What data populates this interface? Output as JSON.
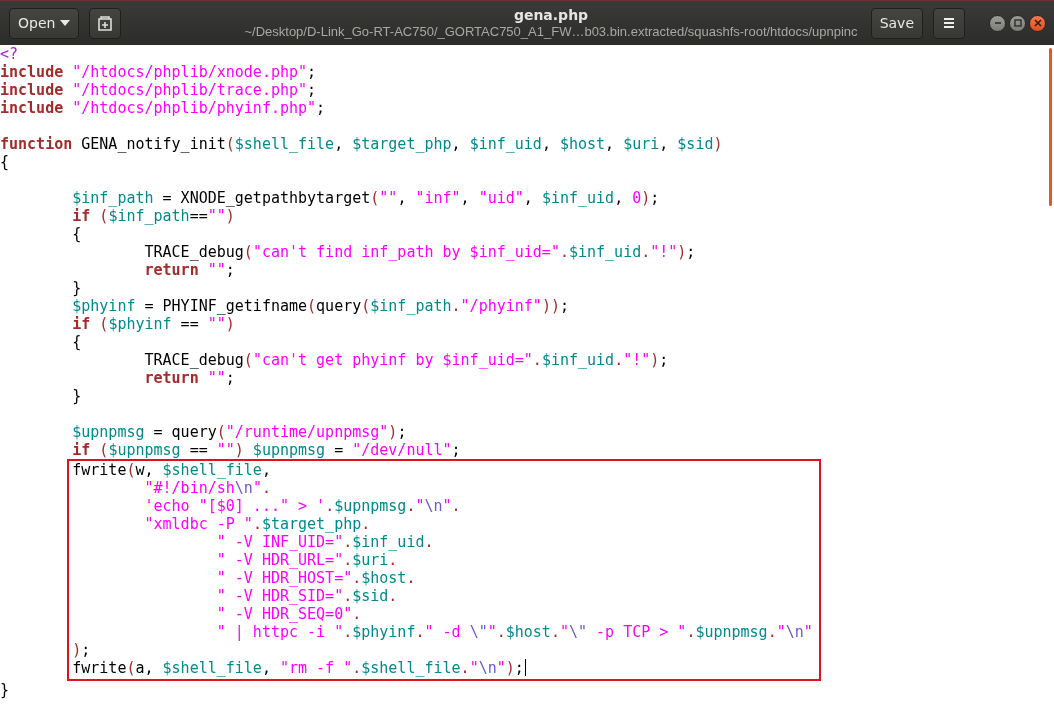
{
  "window": {
    "title": "gena.php",
    "subtitle": "~/Desktop/D-Link_Go-RT-AC750/_GORTAC750_A1_FW…b03.bin.extracted/squashfs-root/htdocs/upnpinc",
    "open_button": "Open",
    "save_button": "Save"
  },
  "editor": {
    "segments": [
      {
        "highlighted": false,
        "blocks": [
          {
            "lines": [
              {
                "tokens": [
                  {
                    "kind": "tag",
                    "text": "<?"
                  }
                ]
              },
              {
                "tokens": [
                  {
                    "kind": "keyword",
                    "text": "include "
                  },
                  {
                    "kind": "string",
                    "text": "\"/htdocs/phplib/xnode.php\""
                  },
                  {
                    "kind": "plain",
                    "text": ";"
                  }
                ]
              },
              {
                "tokens": [
                  {
                    "kind": "keyword",
                    "text": "include "
                  },
                  {
                    "kind": "string",
                    "text": "\"/htdocs/phplib/trace.php\""
                  },
                  {
                    "kind": "plain",
                    "text": ";"
                  }
                ]
              },
              {
                "tokens": [
                  {
                    "kind": "keyword",
                    "text": "include "
                  },
                  {
                    "kind": "string",
                    "text": "\"/htdocs/phplib/phyinf.php\""
                  },
                  {
                    "kind": "plain",
                    "text": ";"
                  }
                ]
              }
            ]
          },
          {
            "lines": [
              {
                "tokens": [
                  {
                    "kind": "keyword",
                    "text": "function "
                  },
                  {
                    "kind": "plain",
                    "text": "GENA_notify_init"
                  },
                  {
                    "kind": "op",
                    "text": "("
                  },
                  {
                    "kind": "variable",
                    "text": "$shell_file"
                  },
                  {
                    "kind": "plain",
                    "text": ", "
                  },
                  {
                    "kind": "variable",
                    "text": "$target_php"
                  },
                  {
                    "kind": "plain",
                    "text": ", "
                  },
                  {
                    "kind": "variable",
                    "text": "$inf_uid"
                  },
                  {
                    "kind": "plain",
                    "text": ", "
                  },
                  {
                    "kind": "variable",
                    "text": "$host"
                  },
                  {
                    "kind": "plain",
                    "text": ", "
                  },
                  {
                    "kind": "variable",
                    "text": "$uri"
                  },
                  {
                    "kind": "plain",
                    "text": ", "
                  },
                  {
                    "kind": "variable",
                    "text": "$sid"
                  },
                  {
                    "kind": "op",
                    "text": ")"
                  }
                ]
              },
              {
                "tokens": [
                  {
                    "kind": "plain",
                    "text": "{"
                  }
                ]
              }
            ]
          },
          {
            "lines": [
              {
                "tokens": [
                  {
                    "kind": "variable",
                    "text": "\t$inf_path"
                  },
                  {
                    "kind": "plain",
                    "text": " = XNODE_getpathbytarget"
                  },
                  {
                    "kind": "op",
                    "text": "("
                  },
                  {
                    "kind": "string",
                    "text": "\"\""
                  },
                  {
                    "kind": "plain",
                    "text": ", "
                  },
                  {
                    "kind": "string",
                    "text": "\"inf\""
                  },
                  {
                    "kind": "plain",
                    "text": ", "
                  },
                  {
                    "kind": "string",
                    "text": "\"uid\""
                  },
                  {
                    "kind": "plain",
                    "text": ", "
                  },
                  {
                    "kind": "variable",
                    "text": "$inf_uid"
                  },
                  {
                    "kind": "plain",
                    "text": ", "
                  },
                  {
                    "kind": "number",
                    "text": "0"
                  },
                  {
                    "kind": "op",
                    "text": ")"
                  },
                  {
                    "kind": "plain",
                    "text": ";"
                  }
                ]
              },
              {
                "tokens": [
                  {
                    "kind": "keyword",
                    "text": "\tif "
                  },
                  {
                    "kind": "op",
                    "text": "("
                  },
                  {
                    "kind": "variable",
                    "text": "$inf_path"
                  },
                  {
                    "kind": "plain",
                    "text": "=="
                  },
                  {
                    "kind": "string",
                    "text": "\"\""
                  },
                  {
                    "kind": "op",
                    "text": ")"
                  }
                ]
              },
              {
                "tokens": [
                  {
                    "kind": "plain",
                    "text": "\t{"
                  }
                ]
              },
              {
                "tokens": [
                  {
                    "kind": "plain",
                    "text": "\t\tTRACE_debug"
                  },
                  {
                    "kind": "op",
                    "text": "("
                  },
                  {
                    "kind": "string",
                    "text": "\"can't find inf_path by $inf_uid=\""
                  },
                  {
                    "kind": "op",
                    "text": "."
                  },
                  {
                    "kind": "variable",
                    "text": "$inf_uid"
                  },
                  {
                    "kind": "op",
                    "text": "."
                  },
                  {
                    "kind": "string",
                    "text": "\"!\""
                  },
                  {
                    "kind": "op",
                    "text": ")"
                  },
                  {
                    "kind": "plain",
                    "text": ";"
                  }
                ]
              },
              {
                "tokens": [
                  {
                    "kind": "keyword",
                    "text": "\t\treturn "
                  },
                  {
                    "kind": "string",
                    "text": "\"\""
                  },
                  {
                    "kind": "plain",
                    "text": ";"
                  }
                ]
              },
              {
                "tokens": [
                  {
                    "kind": "plain",
                    "text": "\t}"
                  }
                ]
              },
              {
                "tokens": [
                  {
                    "kind": "variable",
                    "text": "\t$phyinf"
                  },
                  {
                    "kind": "plain",
                    "text": " = PHYINF_getifname"
                  },
                  {
                    "kind": "op",
                    "text": "("
                  },
                  {
                    "kind": "plain",
                    "text": "query"
                  },
                  {
                    "kind": "op",
                    "text": "("
                  },
                  {
                    "kind": "variable",
                    "text": "$inf_path"
                  },
                  {
                    "kind": "op",
                    "text": "."
                  },
                  {
                    "kind": "string",
                    "text": "\"/phyinf\""
                  },
                  {
                    "kind": "op",
                    "text": "))"
                  },
                  {
                    "kind": "plain",
                    "text": ";"
                  }
                ]
              },
              {
                "tokens": [
                  {
                    "kind": "keyword",
                    "text": "\tif "
                  },
                  {
                    "kind": "op",
                    "text": "("
                  },
                  {
                    "kind": "variable",
                    "text": "$phyinf"
                  },
                  {
                    "kind": "plain",
                    "text": " == "
                  },
                  {
                    "kind": "string",
                    "text": "\"\""
                  },
                  {
                    "kind": "op",
                    "text": ")"
                  }
                ]
              },
              {
                "tokens": [
                  {
                    "kind": "plain",
                    "text": "\t{"
                  }
                ]
              },
              {
                "tokens": [
                  {
                    "kind": "plain",
                    "text": "\t\tTRACE_debug"
                  },
                  {
                    "kind": "op",
                    "text": "("
                  },
                  {
                    "kind": "string",
                    "text": "\"can't get phyinf by $inf_uid=\""
                  },
                  {
                    "kind": "op",
                    "text": "."
                  },
                  {
                    "kind": "variable",
                    "text": "$inf_uid"
                  },
                  {
                    "kind": "op",
                    "text": "."
                  },
                  {
                    "kind": "string",
                    "text": "\"!\""
                  },
                  {
                    "kind": "op",
                    "text": ")"
                  },
                  {
                    "kind": "plain",
                    "text": ";"
                  }
                ]
              },
              {
                "tokens": [
                  {
                    "kind": "keyword",
                    "text": "\t\treturn "
                  },
                  {
                    "kind": "string",
                    "text": "\"\""
                  },
                  {
                    "kind": "plain",
                    "text": ";"
                  }
                ]
              },
              {
                "tokens": [
                  {
                    "kind": "plain",
                    "text": "\t}"
                  }
                ]
              }
            ]
          },
          {
            "lines": [
              {
                "tokens": [
                  {
                    "kind": "variable",
                    "text": "\t$upnpmsg"
                  },
                  {
                    "kind": "plain",
                    "text": " = query"
                  },
                  {
                    "kind": "op",
                    "text": "("
                  },
                  {
                    "kind": "string",
                    "text": "\"/runtime/upnpmsg\""
                  },
                  {
                    "kind": "op",
                    "text": ")"
                  },
                  {
                    "kind": "plain",
                    "text": ";"
                  }
                ]
              },
              {
                "tokens": [
                  {
                    "kind": "keyword",
                    "text": "\tif "
                  },
                  {
                    "kind": "op",
                    "text": "("
                  },
                  {
                    "kind": "variable",
                    "text": "$upnpmsg"
                  },
                  {
                    "kind": "plain",
                    "text": " == "
                  },
                  {
                    "kind": "string",
                    "text": "\"\""
                  },
                  {
                    "kind": "op",
                    "text": ")"
                  },
                  {
                    "kind": "variable",
                    "text": " $upnpmsg"
                  },
                  {
                    "kind": "plain",
                    "text": " = "
                  },
                  {
                    "kind": "string",
                    "text": "\"/dev/null\""
                  },
                  {
                    "kind": "plain",
                    "text": ";"
                  }
                ]
              }
            ]
          }
        ]
      },
      {
        "highlighted": true,
        "blocks": [
          {
            "lines": [
              {
                "tokens": [
                  {
                    "kind": "plain",
                    "text": "\tfwrite"
                  },
                  {
                    "kind": "op",
                    "text": "("
                  },
                  {
                    "kind": "plain",
                    "text": "w, "
                  },
                  {
                    "kind": "variable",
                    "text": "$shell_file"
                  },
                  {
                    "kind": "plain",
                    "text": ","
                  }
                ]
              },
              {
                "tokens": [
                  {
                    "kind": "string",
                    "text": "\t\t\"#!/bin/sh"
                  },
                  {
                    "kind": "escape",
                    "text": "\\n"
                  },
                  {
                    "kind": "string",
                    "text": "\""
                  },
                  {
                    "kind": "op",
                    "text": "."
                  }
                ]
              },
              {
                "tokens": [
                  {
                    "kind": "string",
                    "text": "\t\t'echo \"[$0] ...\" > '"
                  },
                  {
                    "kind": "op",
                    "text": "."
                  },
                  {
                    "kind": "variable",
                    "text": "$upnpmsg"
                  },
                  {
                    "kind": "op",
                    "text": "."
                  },
                  {
                    "kind": "string",
                    "text": "\""
                  },
                  {
                    "kind": "escape",
                    "text": "\\n"
                  },
                  {
                    "kind": "string",
                    "text": "\""
                  },
                  {
                    "kind": "op",
                    "text": "."
                  }
                ]
              },
              {
                "tokens": [
                  {
                    "kind": "string",
                    "text": "\t\t\"xmldbc -P \""
                  },
                  {
                    "kind": "op",
                    "text": "."
                  },
                  {
                    "kind": "variable",
                    "text": "$target_php"
                  },
                  {
                    "kind": "op",
                    "text": "."
                  }
                ]
              },
              {
                "tokens": [
                  {
                    "kind": "string",
                    "text": "\t\t\t\" -V INF_UID=\""
                  },
                  {
                    "kind": "op",
                    "text": "."
                  },
                  {
                    "kind": "variable",
                    "text": "$inf_uid"
                  },
                  {
                    "kind": "op",
                    "text": "."
                  }
                ]
              },
              {
                "tokens": [
                  {
                    "kind": "string",
                    "text": "\t\t\t\" -V HDR_URL=\""
                  },
                  {
                    "kind": "op",
                    "text": "."
                  },
                  {
                    "kind": "variable",
                    "text": "$uri"
                  },
                  {
                    "kind": "op",
                    "text": "."
                  }
                ]
              },
              {
                "tokens": [
                  {
                    "kind": "string",
                    "text": "\t\t\t\" -V HDR_HOST=\""
                  },
                  {
                    "kind": "op",
                    "text": "."
                  },
                  {
                    "kind": "variable",
                    "text": "$host"
                  },
                  {
                    "kind": "op",
                    "text": "."
                  }
                ]
              },
              {
                "tokens": [
                  {
                    "kind": "string",
                    "text": "\t\t\t\" -V HDR_SID=\""
                  },
                  {
                    "kind": "op",
                    "text": "."
                  },
                  {
                    "kind": "variable",
                    "text": "$sid"
                  },
                  {
                    "kind": "op",
                    "text": "."
                  }
                ]
              },
              {
                "tokens": [
                  {
                    "kind": "string",
                    "text": "\t\t\t\" -V HDR_SEQ=0\""
                  },
                  {
                    "kind": "op",
                    "text": "."
                  }
                ]
              },
              {
                "tokens": [
                  {
                    "kind": "string",
                    "text": "\t\t\t\" | httpc -i \""
                  },
                  {
                    "kind": "op",
                    "text": "."
                  },
                  {
                    "kind": "variable",
                    "text": "$phyinf"
                  },
                  {
                    "kind": "op",
                    "text": "."
                  },
                  {
                    "kind": "string",
                    "text": "\" -d "
                  },
                  {
                    "kind": "escape",
                    "text": "\\\""
                  },
                  {
                    "kind": "string",
                    "text": "\""
                  },
                  {
                    "kind": "op",
                    "text": "."
                  },
                  {
                    "kind": "variable",
                    "text": "$host"
                  },
                  {
                    "kind": "op",
                    "text": "."
                  },
                  {
                    "kind": "string",
                    "text": "\""
                  },
                  {
                    "kind": "escape",
                    "text": "\\\""
                  },
                  {
                    "kind": "string",
                    "text": " -p TCP > \""
                  },
                  {
                    "kind": "op",
                    "text": "."
                  },
                  {
                    "kind": "variable",
                    "text": "$upnpmsg"
                  },
                  {
                    "kind": "op",
                    "text": "."
                  },
                  {
                    "kind": "string",
                    "text": "\""
                  },
                  {
                    "kind": "escape",
                    "text": "\\n"
                  },
                  {
                    "kind": "string",
                    "text": "\""
                  }
                ]
              },
              {
                "tokens": [
                  {
                    "kind": "op",
                    "text": "\t)"
                  },
                  {
                    "kind": "plain",
                    "text": ";"
                  }
                ]
              },
              {
                "cursor": true,
                "tokens": [
                  {
                    "kind": "plain",
                    "text": "\tfwrite"
                  },
                  {
                    "kind": "op",
                    "text": "("
                  },
                  {
                    "kind": "plain",
                    "text": "a, "
                  },
                  {
                    "kind": "variable",
                    "text": "$shell_file"
                  },
                  {
                    "kind": "plain",
                    "text": ", "
                  },
                  {
                    "kind": "string",
                    "text": "\"rm -f \""
                  },
                  {
                    "kind": "op",
                    "text": "."
                  },
                  {
                    "kind": "variable",
                    "text": "$shell_file"
                  },
                  {
                    "kind": "op",
                    "text": "."
                  },
                  {
                    "kind": "string",
                    "text": "\""
                  },
                  {
                    "kind": "escape",
                    "text": "\\n"
                  },
                  {
                    "kind": "string",
                    "text": "\""
                  },
                  {
                    "kind": "op",
                    "text": ")"
                  },
                  {
                    "kind": "plain",
                    "text": ";"
                  }
                ]
              }
            ]
          }
        ]
      },
      {
        "highlighted": false,
        "blocks": [
          {
            "lines": [
              {
                "tokens": [
                  {
                    "kind": "plain",
                    "text": "}"
                  }
                ]
              }
            ]
          }
        ]
      }
    ]
  }
}
